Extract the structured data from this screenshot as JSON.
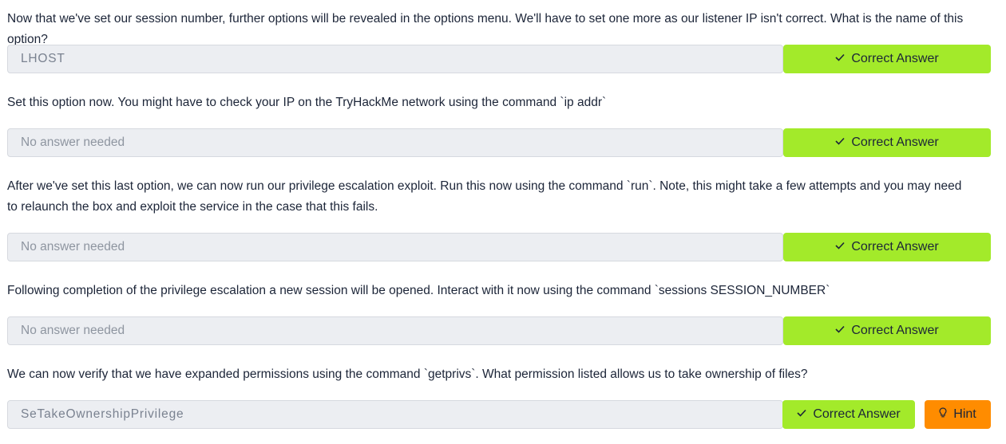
{
  "tasks": [
    {
      "question": "Now that we've set our session number, further options will be revealed in the options menu. We'll have to set one more as our listener IP isn't correct. What is the name of this option?",
      "answer": "LHOST",
      "correct_label": "Correct Answer"
    },
    {
      "question": "Set this option now. You might have to check your IP on the TryHackMe network using the command `ip addr`",
      "answer": "No answer needed",
      "correct_label": "Correct Answer"
    },
    {
      "question": "After we've set this last option, we can now run our privilege escalation exploit. Run this now using the command `run`. Note, this might take a few attempts and you may need to relaunch the box and exploit the service in the case that this fails.",
      "answer": "No answer needed",
      "correct_label": "Correct Answer"
    },
    {
      "question": "Following completion of the privilege escalation a new session will be opened. Interact with it now using the command `sessions SESSION_NUMBER`",
      "answer": "No answer needed",
      "correct_label": "Correct Answer"
    },
    {
      "question": "We can now verify that we have expanded permissions using the command `getprivs`. What permission listed allows us to take ownership of files?",
      "answer": "SeTakeOwnershipPrivilege",
      "correct_label": "Correct Answer",
      "hint_label": "Hint"
    }
  ],
  "icons": {
    "check": "check-icon",
    "hint": "lightbulb-icon"
  },
  "colors": {
    "correct": "#a3ea2a",
    "hint": "#ff8c00",
    "field_bg": "#eceef2"
  }
}
